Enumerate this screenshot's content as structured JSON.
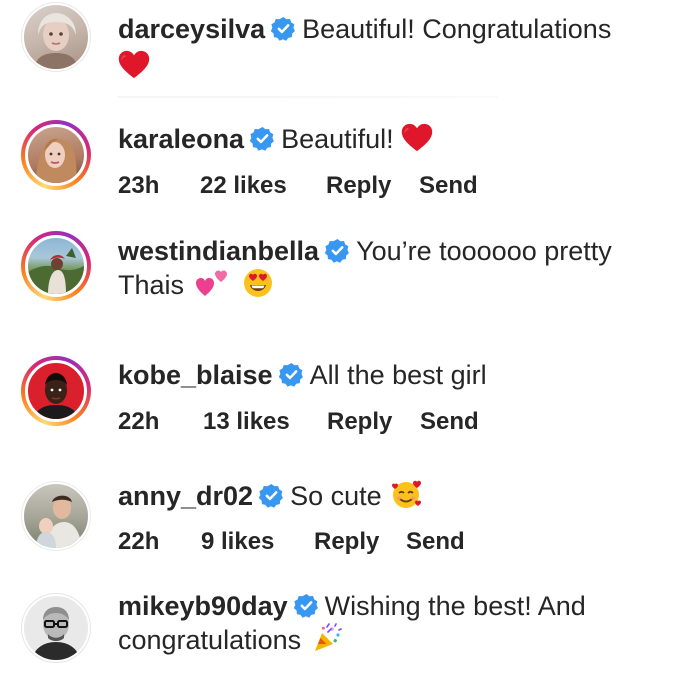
{
  "comments": [
    {
      "username": "darceysilva",
      "line1": "Beautiful! Congratulations",
      "line2": "",
      "emoji_end": "heart-emoji",
      "time": "",
      "likes": "",
      "reply": "",
      "send": ""
    },
    {
      "username": "karaleona",
      "line1": "Beautiful!",
      "emoji_end": "heart-emoji",
      "time": "23h",
      "likes": "22 likes",
      "reply": "Reply",
      "send": "Send"
    },
    {
      "username": "westindianbella",
      "line1": "You’re toooooo pretty",
      "line2": "Thais",
      "emoji_end": "hearts-and-heart-eyes-emoji",
      "time": "",
      "likes": "",
      "reply": "",
      "send": ""
    },
    {
      "username": "kobe_blaise",
      "line1": "All the best girl",
      "time": "22h",
      "likes": "13 likes",
      "reply": "Reply",
      "send": "Send"
    },
    {
      "username": "anny_dr02",
      "line1": "So cute",
      "emoji_end": "smiling-face-with-hearts-emoji",
      "time": "22h",
      "likes": "9 likes",
      "reply": "Reply",
      "send": "Send"
    },
    {
      "username": "mikeyb90day",
      "line1": "Wishing the best! And",
      "line2": "congratulations",
      "emoji_end": "party-popper-emoji",
      "time": "",
      "likes": "",
      "reply": "",
      "send": ""
    }
  ],
  "colors": {
    "verified": "#3897f0",
    "text": "#262626",
    "ring_start": "#feda75",
    "ring_end": "#d62976"
  }
}
